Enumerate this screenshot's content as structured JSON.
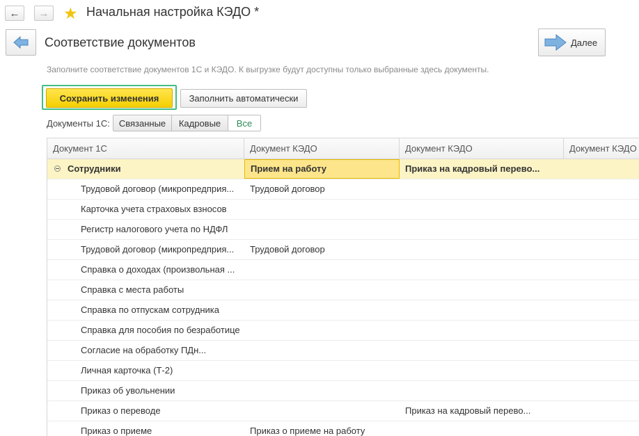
{
  "window": {
    "title": "Начальная настройка КЭДО *"
  },
  "form": {
    "title": "Соответствие документов",
    "next_label": "Далее",
    "hint": "Заполните соответствие документов 1С и КЭДО. К выгрузке будут доступны только выбранные здесь документы."
  },
  "toolbar": {
    "save_label": "Сохранить изменения",
    "autofill_label": "Заполнить автоматически"
  },
  "filter": {
    "label": "Документы 1С:",
    "options": [
      "Связанные",
      "Кадровые",
      "Все"
    ],
    "selected": "Все"
  },
  "table": {
    "columns": [
      "Документ 1С",
      "Документ КЭДО",
      "Документ КЭДО",
      "Документ КЭДО"
    ],
    "group": {
      "label": "Сотрудники",
      "cells": [
        "Прием на работу",
        "Приказ на кадровый перево..."
      ]
    },
    "rows": [
      {
        "doc": "Трудовой договор (микропредприя...",
        "k1": "Трудовой договор",
        "k2": ""
      },
      {
        "doc": "Карточка учета страховых взносов",
        "k1": "",
        "k2": ""
      },
      {
        "doc": "Регистр налогового учета по НДФЛ",
        "k1": "",
        "k2": ""
      },
      {
        "doc": "Трудовой договор (микропредприя...",
        "k1": "Трудовой договор",
        "k2": ""
      },
      {
        "doc": "Справка о доходах (произвольная ...",
        "k1": "",
        "k2": ""
      },
      {
        "doc": "Справка с места работы",
        "k1": "",
        "k2": ""
      },
      {
        "doc": "Справка по отпускам сотрудника",
        "k1": "",
        "k2": ""
      },
      {
        "doc": "Справка для пособия по безработице",
        "k1": "",
        "k2": ""
      },
      {
        "doc": "Согласие на обработку ПДн...",
        "k1": "",
        "k2": ""
      },
      {
        "doc": "Личная карточка (Т-2)",
        "k1": "",
        "k2": ""
      },
      {
        "doc": "Приказ об увольнении",
        "k1": "",
        "k2": ""
      },
      {
        "doc": "Приказ о переводе",
        "k1": "",
        "k2": "Приказ на кадровый перево..."
      },
      {
        "doc": "Приказ о приеме",
        "k1": "Приказ о приеме на работу",
        "k2": ""
      }
    ]
  },
  "colors": {
    "accent_yellow": "#f5cf00",
    "focus_green": "#3fbf7f",
    "selected_cell": "#fde58b",
    "group_row": "#fcf4c5"
  }
}
